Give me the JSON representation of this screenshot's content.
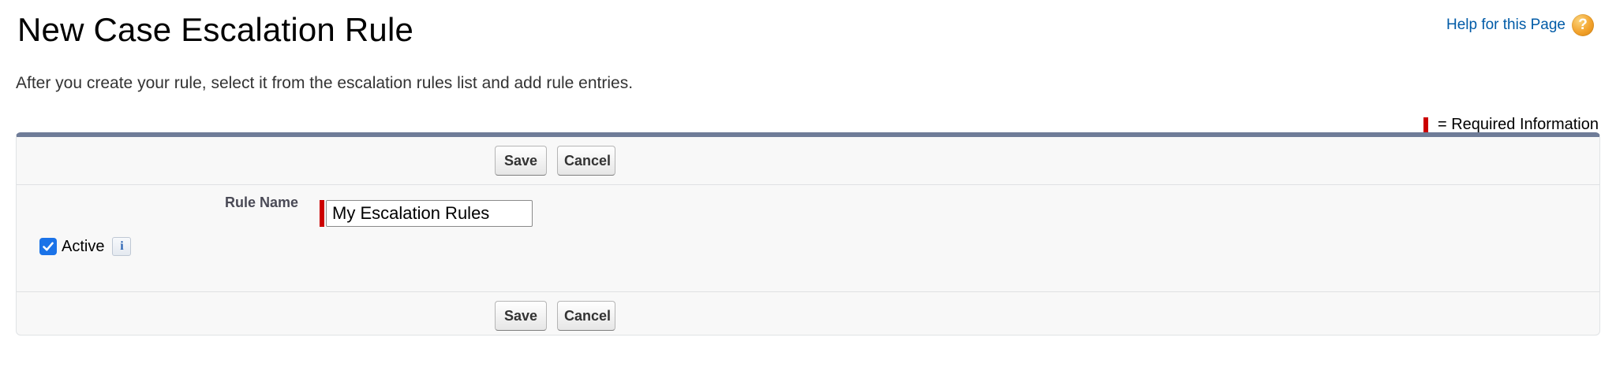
{
  "header": {
    "title": "New Case Escalation Rule",
    "help_link": "Help for this Page",
    "help_icon": "?"
  },
  "description": "After you create your rule, select it from the escalation rules list and add rule entries.",
  "required_legend": "= Required Information",
  "buttons": {
    "save": "Save",
    "cancel": "Cancel"
  },
  "form": {
    "rule_name_label": "Rule Name",
    "rule_name_value": "My Escalation Rules",
    "active_label": "Active",
    "active_checked": true,
    "info_icon": "i"
  },
  "colors": {
    "accent_blue": "#015ba7",
    "required_red": "#cc0000",
    "panel_border_top": "#6f7c98",
    "checkbox_blue": "#1b73e8"
  }
}
